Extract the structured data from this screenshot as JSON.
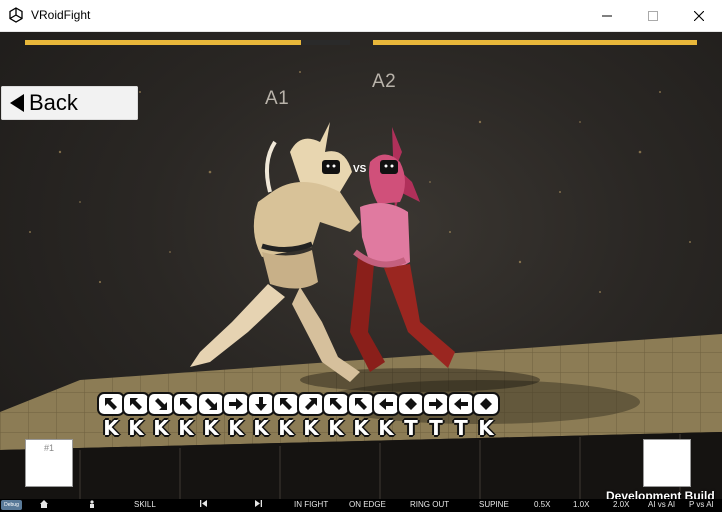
{
  "window": {
    "title": "VRoidFight",
    "app_icon": "unity-icon",
    "controls": [
      "minimize-icon",
      "maximize-icon",
      "close-icon"
    ]
  },
  "hud": {
    "player_left_hp": 0.85,
    "player_right_hp": 1.0,
    "bar_color": "#e8b73a",
    "back_label": "Back",
    "tag_left": "A1",
    "tag_right": "A2",
    "vs_label": "VS"
  },
  "command_list": {
    "arrows": [
      "up-left",
      "up-left",
      "down-right",
      "up-left",
      "down-right",
      "right",
      "down",
      "up-left",
      "up-right",
      "up-left",
      "up-left",
      "left",
      "diamond",
      "right",
      "left",
      "diamond"
    ],
    "keys": [
      "K",
      "K",
      "K",
      "K",
      "K",
      "K",
      "K",
      "K",
      "K",
      "K",
      "K",
      "K",
      "T",
      "T",
      "T",
      "K"
    ]
  },
  "slots": {
    "left_label": "#1"
  },
  "dev_build_label": "Development Build",
  "status_bar": {
    "items": [
      {
        "icon": "home-icon"
      },
      {
        "icon": "person-icon"
      },
      {
        "label": "SKILL"
      },
      {
        "icon": "prev-icon"
      },
      {
        "icon": "next-icon"
      },
      {
        "label": "IN FIGHT"
      },
      {
        "label": "ON EDGE"
      },
      {
        "label": "RING OUT"
      },
      {
        "label": "SUPINE"
      },
      {
        "label": "0.5X"
      },
      {
        "label": "1.0X"
      },
      {
        "label": "2.0X"
      },
      {
        "label": "AI vs AI"
      },
      {
        "label": "P vs AI"
      }
    ]
  }
}
